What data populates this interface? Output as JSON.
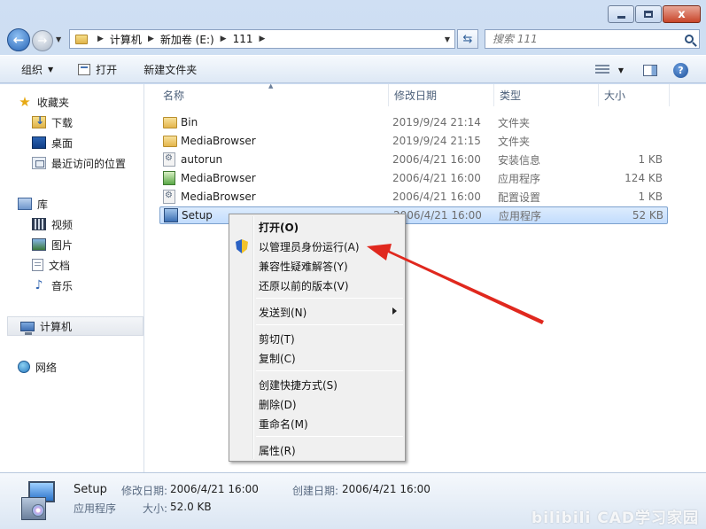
{
  "window": {
    "minimize": "",
    "maximize": "",
    "close": "x"
  },
  "address": {
    "segments": [
      "计算机",
      "新加卷 (E:)",
      "111"
    ]
  },
  "search": {
    "placeholder": "搜索 111"
  },
  "toolbar": {
    "organize": "组织",
    "open": "打开",
    "new_folder": "新建文件夹"
  },
  "navpane": {
    "favorites": "收藏夹",
    "downloads": "下载",
    "desktop": "桌面",
    "recent": "最近访问的位置",
    "libraries": "库",
    "videos": "视频",
    "pictures": "图片",
    "documents": "文档",
    "music": "音乐",
    "computer": "计算机",
    "network": "网络"
  },
  "columns": {
    "name": "名称",
    "date": "修改日期",
    "type": "类型",
    "size": "大小"
  },
  "files": [
    {
      "name": "Bin",
      "date": "2019/9/24 21:14",
      "type": "文件夹",
      "size": "",
      "icon": "folder-icon"
    },
    {
      "name": "MediaBrowser",
      "date": "2019/9/24 21:15",
      "type": "文件夹",
      "size": "",
      "icon": "folder-icon"
    },
    {
      "name": "autorun",
      "date": "2006/4/21 16:00",
      "type": "安装信息",
      "size": "1 KB",
      "icon": "setup-info-icon"
    },
    {
      "name": "MediaBrowser",
      "date": "2006/4/21 16:00",
      "type": "应用程序",
      "size": "124 KB",
      "icon": "application-icon"
    },
    {
      "name": "MediaBrowser",
      "date": "2006/4/21 16:00",
      "type": "配置设置",
      "size": "1 KB",
      "icon": "config-settings-icon"
    },
    {
      "name": "Setup",
      "date": "2006/4/21 16:00",
      "type": "应用程序",
      "size": "52 KB",
      "icon": "setup-icon"
    }
  ],
  "context_menu": {
    "open": "打开(O)",
    "run_as_admin": "以管理员身份运行(A)",
    "troubleshoot": "兼容性疑难解答(Y)",
    "restore": "还原以前的版本(V)",
    "send_to": "发送到(N)",
    "cut": "剪切(T)",
    "copy": "复制(C)",
    "create_shortcut": "创建快捷方式(S)",
    "delete": "删除(D)",
    "rename": "重命名(M)",
    "properties": "属性(R)"
  },
  "details": {
    "name": "Setup",
    "type": "应用程序",
    "modified_label": "修改日期:",
    "modified_value": "2006/4/21 16:00",
    "created_label": "创建日期:",
    "created_value": "2006/4/21 16:00",
    "size_label": "大小:",
    "size_value": "52.0 KB"
  },
  "watermark": "bilibili CAD学习家园",
  "colors": {
    "arrow": "#e0281e",
    "selection": "#c2dcfd"
  }
}
